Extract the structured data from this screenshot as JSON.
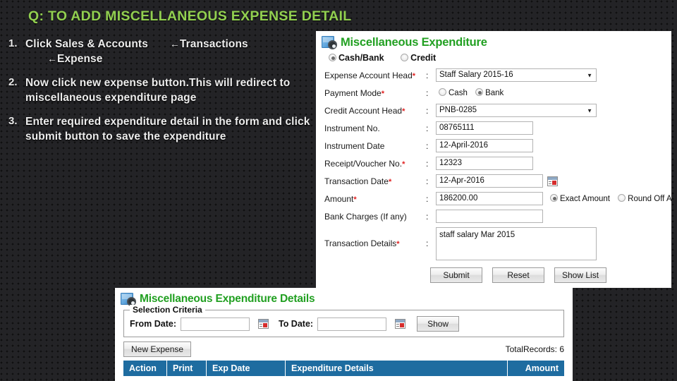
{
  "slide": {
    "title": "Q: TO ADD MISCELLANEOUS EXPENSE DETAIL",
    "title_color": "#92d050",
    "background_color": "#232326"
  },
  "steps": [
    {
      "num": "1.",
      "part1": "Click  Sales & Accounts",
      "arrow1": "←",
      "part2": "Transactions",
      "arrow2": "←",
      "part3": "Expense"
    },
    {
      "num": "2.",
      "text": "Now click new expense button.This will redirect to miscellaneous expenditure page"
    },
    {
      "num": "3.",
      "text": "Enter required expenditure detail in the form and click submit button to save the expenditure"
    }
  ],
  "form_panel": {
    "icon": "app-window-gear-icon",
    "title": "Miscellaneous Expenditure",
    "title_color": "#22a022",
    "type_options": [
      {
        "label": "Cash/Bank",
        "selected": true
      },
      {
        "label": "Credit",
        "selected": false
      }
    ],
    "fields": {
      "expense_account_head": {
        "label": "Expense Account Head",
        "required": "*",
        "colon": ":",
        "value": "Staff Salary 2015-16",
        "caret": "▼"
      },
      "payment_mode": {
        "label": "Payment Mode",
        "required": "*",
        "colon": ":",
        "options": [
          {
            "label": "Cash",
            "selected": false
          },
          {
            "label": "Bank",
            "selected": true
          }
        ]
      },
      "credit_account_head": {
        "label": "Credit Account Head",
        "required": "*",
        "colon": ":",
        "value": "PNB-0285",
        "caret": "▼"
      },
      "instrument_no": {
        "label": "Instrument No.",
        "required": "",
        "colon": ":",
        "value": "08765111"
      },
      "instrument_date": {
        "label": "Instrument Date",
        "required": "",
        "colon": ":",
        "value": "12-April-2016"
      },
      "receipt_voucher_no": {
        "label": "Receipt/Voucher No.",
        "required": "*",
        "colon": ":",
        "value": "12323"
      },
      "transaction_date": {
        "label": "Transaction Date",
        "required": "*",
        "colon": ":",
        "value": "12-Apr-2016",
        "calendar_icon": "calendar-icon"
      },
      "amount": {
        "label": "Amount",
        "required": "*",
        "colon": ":",
        "value": "186200.00",
        "options": [
          {
            "label": "Exact Amount",
            "selected": true
          },
          {
            "label": "Round Off Amount",
            "selected": false
          }
        ]
      },
      "bank_charges": {
        "label": "Bank Charges (If any)",
        "required": "",
        "colon": ":",
        "value": ""
      },
      "transaction_details": {
        "label": "Transaction Details",
        "required": "*",
        "colon": ":",
        "value": "staff salary Mar 2015"
      }
    },
    "buttons": {
      "submit": "Submit",
      "reset": "Reset",
      "show_list": "Show List"
    }
  },
  "list_panel": {
    "icon": "app-window-gear-icon",
    "title": "Miscellaneous Expenditure Details",
    "title_color": "#22a022",
    "selection_criteria": {
      "legend": "Selection Criteria",
      "from_date_label": "From Date:",
      "from_date_value": "",
      "from_date_picker": "calendar-icon",
      "to_date_label": "To Date:",
      "to_date_value": "",
      "to_date_picker": "calendar-icon",
      "show_button": "Show"
    },
    "new_expense_button": "New Expense",
    "total_records": "TotalRecords: 6",
    "grid_headers": [
      "Action",
      "Print",
      "Exp Date",
      "Expenditure Details",
      "Amount"
    ],
    "grid_header_color": "#1e6ca0"
  }
}
